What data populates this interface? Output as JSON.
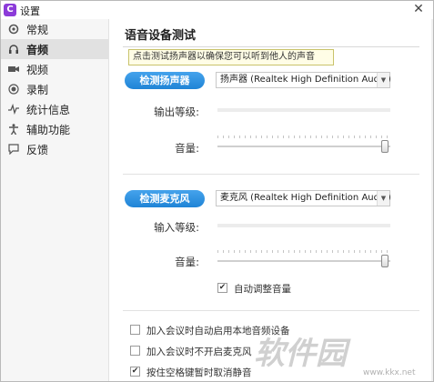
{
  "window": {
    "title": "设置",
    "app_icon_letter": "C",
    "close_glyph": "✕"
  },
  "sidebar": {
    "items": [
      {
        "label": "常规",
        "icon": "gear-icon"
      },
      {
        "label": "音频",
        "icon": "headphones-icon",
        "active": true
      },
      {
        "label": "视频",
        "icon": "camera-icon"
      },
      {
        "label": "录制",
        "icon": "record-icon"
      },
      {
        "label": "统计信息",
        "icon": "stats-icon"
      },
      {
        "label": "辅助功能",
        "icon": "accessibility-icon"
      },
      {
        "label": "反馈",
        "icon": "feedback-icon"
      }
    ]
  },
  "main": {
    "title": "语音设备测试",
    "tooltip": "点击测试扬声器以确保您可以听到他人的声音",
    "speaker": {
      "test_button": "检测扬声器",
      "device": "扬声器 (Realtek High Definition Audio)",
      "output_level_label": "输出等级:",
      "volume_label": "音量:",
      "volume_level": 0.97
    },
    "mic": {
      "test_button": "检测麦克风",
      "device": "麦克风 (Realtek High Definition Audio)",
      "input_level_label": "输入等级:",
      "volume_label": "音量:",
      "volume_level": 0.97,
      "auto_adjust_label": "自动调整音量",
      "auto_adjust_checked": true
    },
    "options": [
      {
        "label": "加入会议时自动启用本地音频设备",
        "checked": false
      },
      {
        "label": "加入会议时不开启麦克风",
        "checked": false
      },
      {
        "label": "按住空格键暂时取消静音",
        "checked": true
      }
    ]
  },
  "watermark": {
    "text": "软件园",
    "url": "www.kkx.net"
  },
  "colors": {
    "accent": "#1f84d6",
    "sidebar_active": "#e1e1e1",
    "tooltip_bg": "#fffde6"
  }
}
